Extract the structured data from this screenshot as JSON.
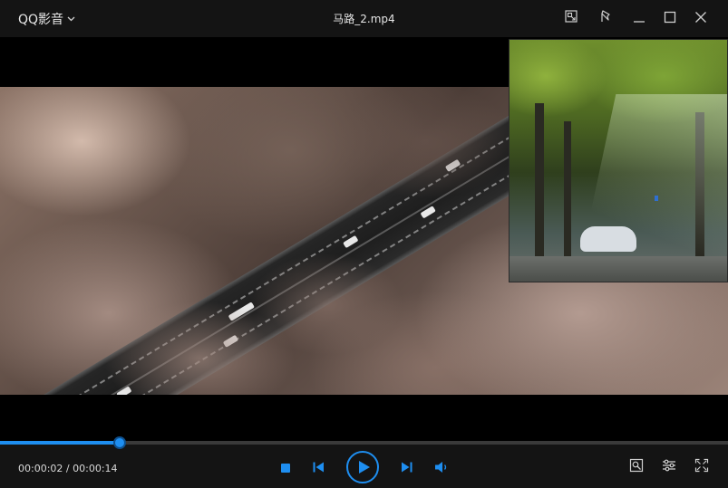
{
  "window": {
    "brand": "QQ影音",
    "title": "马路_2.mp4"
  },
  "playback": {
    "current_time": "00:00:02",
    "separator": "/",
    "total_time": "00:00:14",
    "progress_fraction": 0.165
  },
  "icons": {
    "brand_dropdown": "chevron-down-icon",
    "mini_mode": "mini-mode-icon",
    "pin": "pin-icon",
    "minimize": "minimize-icon",
    "maximize": "maximize-icon",
    "close": "close-icon",
    "stop": "stop-icon",
    "previous": "skip-previous-icon",
    "play": "play-icon",
    "next": "skip-next-icon",
    "volume": "volume-icon",
    "screenshot": "screenshot-icon",
    "settings": "equalizer-settings-icon",
    "fullscreen": "fullscreen-icon"
  },
  "colors": {
    "accent": "#1e8ef0",
    "chrome": "#141414",
    "text": "#e6e6e6"
  }
}
